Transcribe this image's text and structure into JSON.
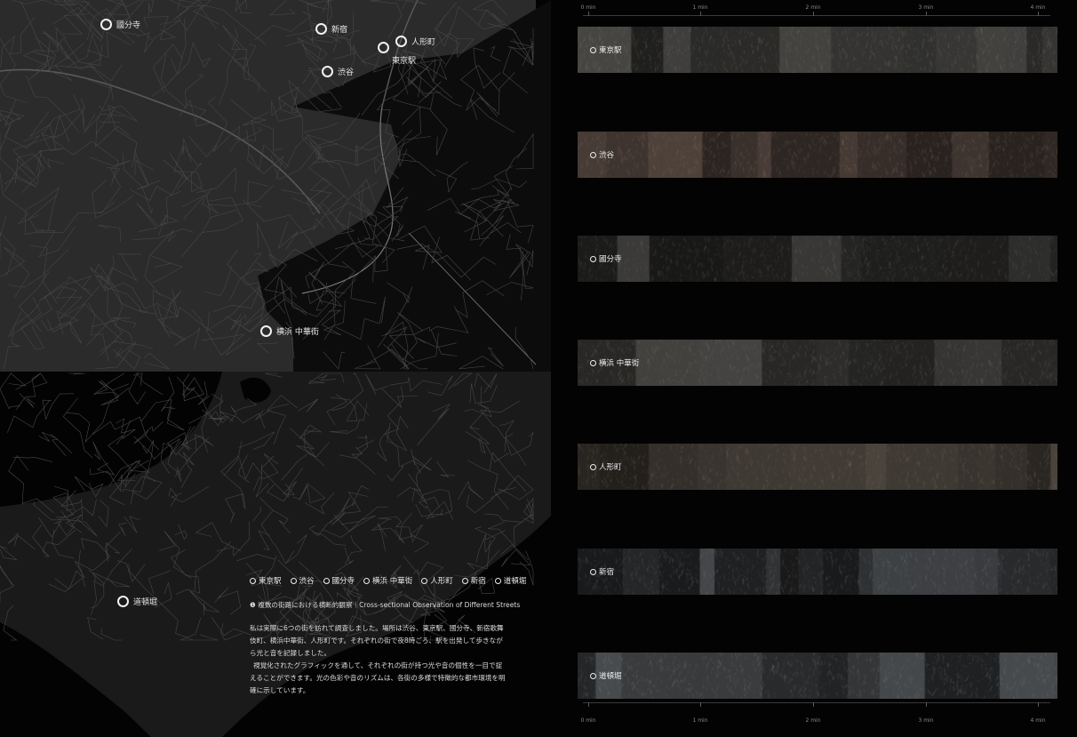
{
  "map": {
    "pins": [
      {
        "label": "國分寺"
      },
      {
        "label": "新宿"
      },
      {
        "label": "人形町"
      },
      {
        "label": ""
      },
      {
        "label": "東京駅"
      },
      {
        "label": "渋谷"
      },
      {
        "label": "横浜 中華街"
      },
      {
        "label": "道頓堀"
      }
    ]
  },
  "legend": {
    "items": [
      "東京駅",
      "渋谷",
      "國分寺",
      "横浜 中華街",
      "人形町",
      "新宿",
      "道頓堀"
    ]
  },
  "caption": "❶ 複数の街路における横断的観察｜Cross-sectional Observation of Different Streets",
  "body": {
    "paragraphs": [
      "私は実際に6つの街を訪れて調査しました。場所は渋谷、東京駅、國分寺、新宿歌舞伎町、横浜中華街、人形町です。それぞれの街で夜8時ごろ、駅を出発して歩きながら光と音を記録しました。",
      "視覚化されたグラフィックを通して、それぞれの街が持つ光や音の個性を一目で捉えることができます。光の色彩や音のリズムは、各街の多様で特徴的な都市環境を明確に示しています。"
    ]
  },
  "timeline": {
    "ticks": [
      "0 min",
      "1 min",
      "2 min",
      "3 min",
      "4 min"
    ],
    "rows": [
      {
        "label": "東京駅",
        "tint": "#a7a49d"
      },
      {
        "label": "渋谷",
        "tint": "#b79a8a"
      },
      {
        "label": "國分寺",
        "tint": "#8d8b86"
      },
      {
        "label": "横浜 中華街",
        "tint": "#9d9a94"
      },
      {
        "label": "人形町",
        "tint": "#a49686"
      },
      {
        "label": "新宿",
        "tint": "#9aa0a6"
      },
      {
        "label": "道頓堀",
        "tint": "#a1a6ab"
      }
    ]
  },
  "colors": {
    "background": "#030303",
    "map_land": "#2c2c2c",
    "map_water": "#0b0b0b",
    "road": "#4a4a4a"
  }
}
